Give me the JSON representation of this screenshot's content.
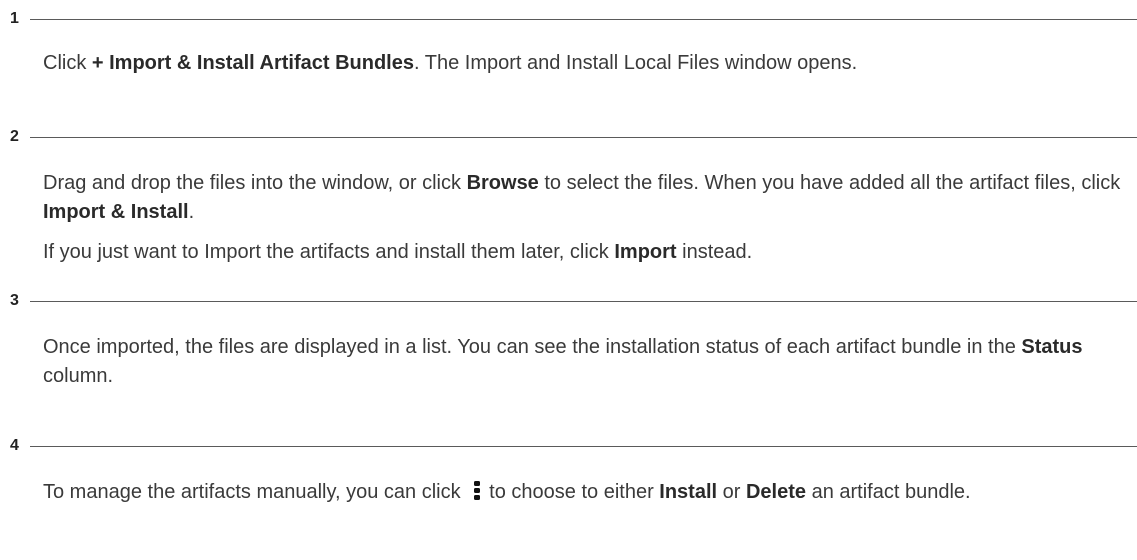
{
  "steps": [
    {
      "number": "1",
      "paragraphs": [
        {
          "parts": [
            {
              "t": "Click "
            },
            {
              "b": "+ Import & Install Artifact Bundles"
            },
            {
              "t": ". The Import and Install Local Files window opens."
            }
          ]
        }
      ]
    },
    {
      "number": "2",
      "paragraphs": [
        {
          "parts": [
            {
              "t": "Drag and drop the files into the window, or click "
            },
            {
              "b": "Browse"
            },
            {
              "t": " to select the files. When you have added all the artifact files, click "
            },
            {
              "b": "Import & Install"
            },
            {
              "t": "."
            }
          ]
        },
        {
          "parts": [
            {
              "t": "If you just want to Import the artifacts and install them later, click "
            },
            {
              "b": "Import"
            },
            {
              "t": " instead."
            }
          ]
        }
      ]
    },
    {
      "number": "3",
      "paragraphs": [
        {
          "parts": [
            {
              "t": "Once imported, the files are displayed in a list. You can see the installation status of each artifact bundle in the "
            },
            {
              "b": "Status"
            },
            {
              "t": " column."
            }
          ]
        }
      ]
    },
    {
      "number": "4",
      "paragraphs": [
        {
          "parts": [
            {
              "t": "To manage the artifacts manually, you can click "
            },
            {
              "icon": "kebab-menu-icon"
            },
            {
              "t": "to choose to either "
            },
            {
              "b": "Install"
            },
            {
              "t": " or "
            },
            {
              "b": "Delete"
            },
            {
              "t": " an artifact bundle."
            }
          ]
        }
      ]
    }
  ]
}
